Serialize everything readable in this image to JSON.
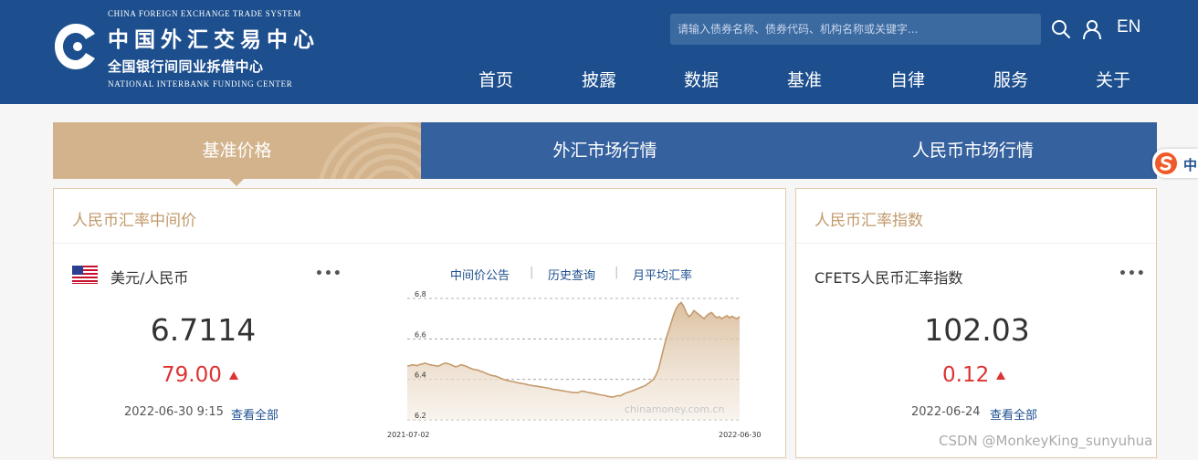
{
  "header": {
    "logo_en_top": "CHINA FOREIGN EXCHANGE TRADE SYSTEM",
    "logo_cn_art": "中国外汇交易中心",
    "logo_cn_sub": "全国银行间同业拆借中心",
    "logo_en_bottom": "NATIONAL INTERBANK FUNDING CENTER",
    "search_placeholder": "请输入债券名称、债券代码、机构名称或关键字...",
    "lang": "EN",
    "nav": [
      "首页",
      "披露",
      "数据",
      "基准",
      "自律",
      "服务",
      "关于"
    ]
  },
  "tabs": [
    "基准价格",
    "外汇市场行情",
    "人民币市场行情"
  ],
  "card_left": {
    "title": "人民币汇率中间价",
    "pair": "美元/人民币",
    "value": "6.7114",
    "change": "79.00",
    "datetime": "2022-06-30 9:15",
    "view_all": "查看全部",
    "links": [
      "中间价公告",
      "历史查询",
      "月平均汇率"
    ],
    "link_sep": "|",
    "more": "•••"
  },
  "card_right": {
    "title": "人民币汇率指数",
    "index_name": "CFETS人民币汇率指数",
    "value": "102.03",
    "change": "0.12",
    "date": "2022-06-24",
    "view_all": "查看全部",
    "more": "•••"
  },
  "chart_data": {
    "type": "area",
    "x_start_label": "2021-07-02",
    "x_end_label": "2022-06-30",
    "y_ticks": [
      "6.8",
      "6.6",
      "6.4",
      "6.2"
    ],
    "ylim": [
      6.2,
      6.8
    ],
    "watermark": "chinamoney.com.cn",
    "values": [
      6.466,
      6.468,
      6.472,
      6.47,
      6.468,
      6.474,
      6.476,
      6.48,
      6.476,
      6.472,
      6.47,
      6.468,
      6.465,
      6.47,
      6.476,
      6.48,
      6.478,
      6.474,
      6.468,
      6.462,
      6.465,
      6.472,
      6.47,
      6.466,
      6.46,
      6.455,
      6.45,
      6.448,
      6.445,
      6.44,
      6.436,
      6.43,
      6.425,
      6.42,
      6.418,
      6.415,
      6.41,
      6.405,
      6.4,
      6.396,
      6.393,
      6.39,
      6.388,
      6.385,
      6.382,
      6.38,
      6.378,
      6.375,
      6.372,
      6.37,
      6.368,
      6.366,
      6.364,
      6.362,
      6.36,
      6.358,
      6.356,
      6.352,
      6.35,
      6.348,
      6.346,
      6.344,
      6.342,
      6.34,
      6.338,
      6.336,
      6.335,
      6.334,
      6.338,
      6.342,
      6.34,
      6.336,
      6.334,
      6.332,
      6.33,
      6.326,
      6.324,
      6.322,
      6.32,
      6.316,
      6.314,
      6.312,
      6.316,
      6.32,
      6.318,
      6.326,
      6.332,
      6.336,
      6.34,
      6.345,
      6.35,
      6.355,
      6.36,
      6.365,
      6.372,
      6.38,
      6.39,
      6.4,
      6.42,
      6.45,
      6.5,
      6.55,
      6.6,
      6.64,
      6.68,
      6.72,
      6.75,
      6.77,
      6.78,
      6.76,
      6.73,
      6.71,
      6.72,
      6.74,
      6.73,
      6.72,
      6.71,
      6.7,
      6.715,
      6.725,
      6.73,
      6.715,
      6.705,
      6.71,
      6.7,
      6.708,
      6.715,
      6.705,
      6.712,
      6.705,
      6.7,
      6.711
    ]
  },
  "side_badge": "中",
  "watermark": "CSDN @MonkeyKing_sunyuhua"
}
